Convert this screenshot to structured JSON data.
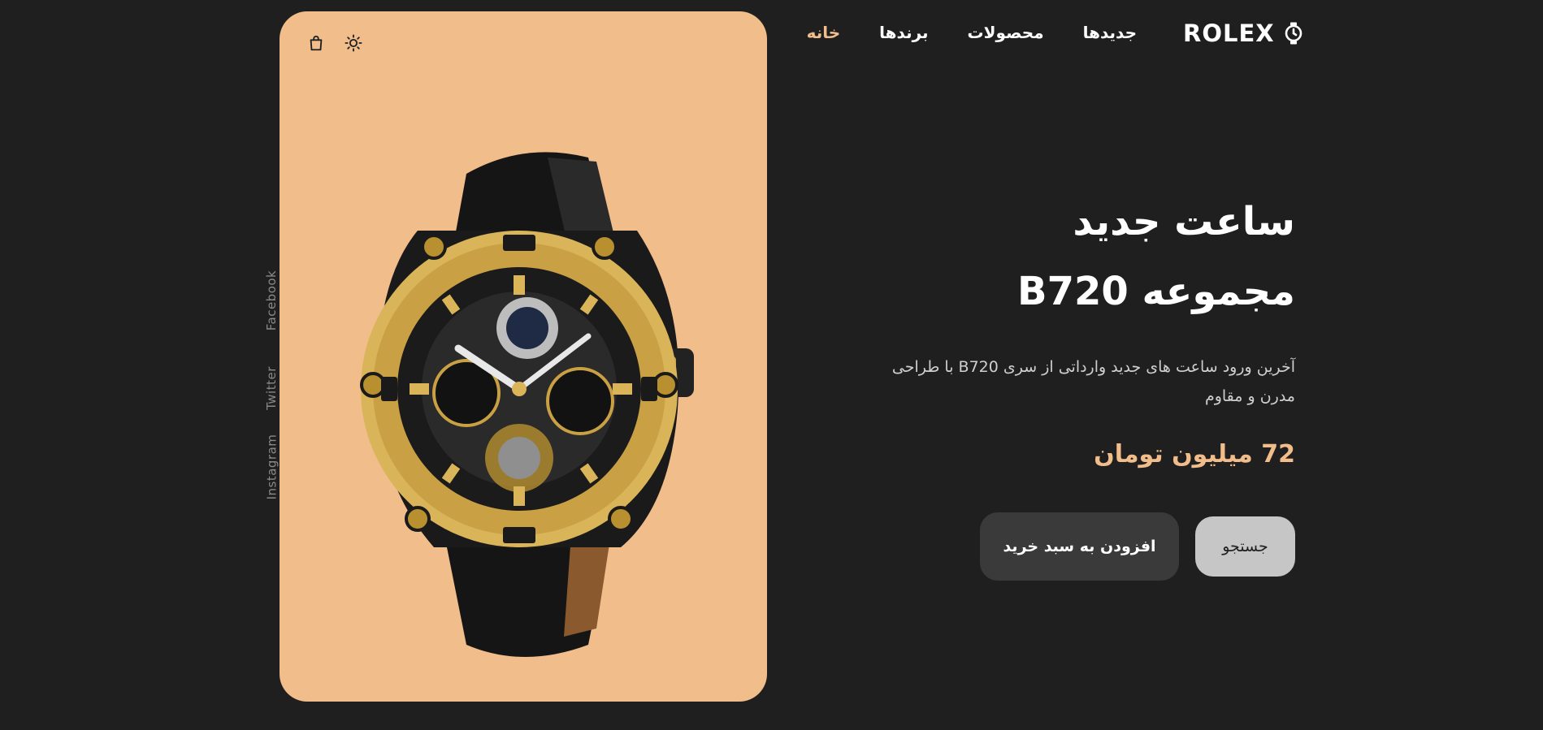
{
  "brand": {
    "name": "ROLEX",
    "icon": "watch-icon"
  },
  "nav": {
    "items": [
      {
        "label": "خانه",
        "active": true
      },
      {
        "label": "برندها",
        "active": false
      },
      {
        "label": "محصولات",
        "active": false
      },
      {
        "label": "جدیدها",
        "active": false
      }
    ]
  },
  "hero": {
    "title_line1": "ساعت جدید",
    "title_line2": "مجموعه B720",
    "description": "آخرین ورود ساعت های جدید وارداتی از سری B720 با طراحی مدرن و مقاوم",
    "price": "72 میلیون تومان"
  },
  "buttons": {
    "search_label": "جستجو",
    "add_to_cart_label": "افزودن به سبد خرید"
  },
  "card": {
    "icons": [
      "shopping-bag-icon",
      "sun-icon"
    ],
    "background": "#f0bd8b"
  },
  "social": {
    "links": [
      "Facebook",
      "Twitter",
      "Instagram"
    ]
  },
  "colors": {
    "background": "#1f1f1f",
    "accent": "#f0bd8b",
    "text": "#ffffff"
  }
}
